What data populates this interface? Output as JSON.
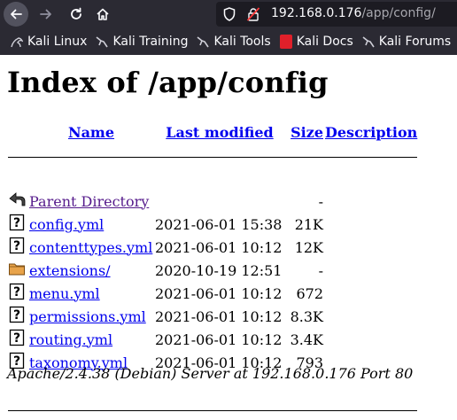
{
  "browser": {
    "url_host": "192.168.0.176",
    "url_path": "/app/config/",
    "bookmarks": [
      "Kali Linux",
      "Kali Training",
      "Kali Tools",
      "Kali Docs",
      "Kali Forums"
    ]
  },
  "page": {
    "title": "Index of /app/config",
    "columns": {
      "name": "Name",
      "modified": "Last modified",
      "size": "Size",
      "description": "Description"
    },
    "parent": {
      "label": "Parent Directory",
      "size": "-"
    },
    "entries": [
      {
        "name": "config.yml",
        "modified": "2021-06-01 15:38",
        "size": "21K",
        "icon": "unknown-file-icon"
      },
      {
        "name": "contenttypes.yml",
        "modified": "2021-06-01 10:12",
        "size": "12K",
        "icon": "unknown-file-icon"
      },
      {
        "name": "extensions/",
        "modified": "2020-10-19 12:51",
        "size": "-",
        "icon": "folder-icon"
      },
      {
        "name": "menu.yml",
        "modified": "2021-06-01 10:12",
        "size": "672",
        "icon": "unknown-file-icon"
      },
      {
        "name": "permissions.yml",
        "modified": "2021-06-01 10:12",
        "size": "8.3K",
        "icon": "unknown-file-icon"
      },
      {
        "name": "routing.yml",
        "modified": "2021-06-01 10:12",
        "size": "3.4K",
        "icon": "unknown-file-icon"
      },
      {
        "name": "taxonomy.yml",
        "modified": "2021-06-01 10:12",
        "size": "793",
        "icon": "unknown-file-icon"
      }
    ],
    "footer": "Apache/2.4.38 (Debian) Server at 192.168.0.176 Port 80"
  }
}
